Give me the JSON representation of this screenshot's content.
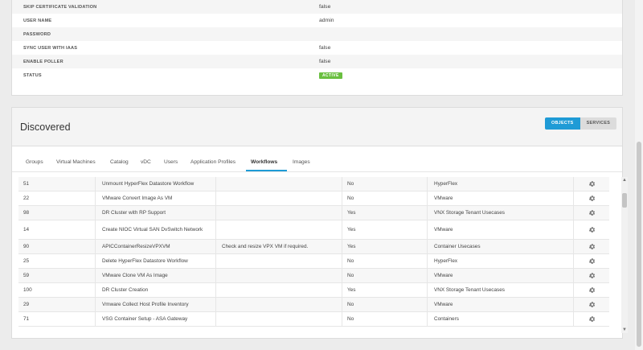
{
  "properties": [
    {
      "key": "SKIP CERTIFICATE VALIDATION",
      "value": "false"
    },
    {
      "key": "USER NAME",
      "value": "admin"
    },
    {
      "key": "PASSWORD",
      "value": ""
    },
    {
      "key": "SYNC USER WITH IAAS",
      "value": "false"
    },
    {
      "key": "ENABLE POLLER",
      "value": "false"
    },
    {
      "key": "STATUS",
      "value": "ACTIVE"
    }
  ],
  "discovered": {
    "title": "Discovered",
    "toggle": {
      "objects": "OBJECTS",
      "services": "SERVICES"
    }
  },
  "tabs": [
    {
      "label": "Groups"
    },
    {
      "label": "Virtual Machines"
    },
    {
      "label": "Catalog"
    },
    {
      "label": "vDC"
    },
    {
      "label": "Users"
    },
    {
      "label": "Application Profiles"
    },
    {
      "label": "Workflows"
    },
    {
      "label": "Images"
    }
  ],
  "workflows": [
    {
      "id": "51",
      "name": "Unmount HyperFlex Datastore Workflow",
      "desc": "",
      "val": "No",
      "cat": "HyperFlex"
    },
    {
      "id": "22",
      "name": "VMware Convert Image As VM",
      "desc": "",
      "val": "No",
      "cat": "VMware"
    },
    {
      "id": "98",
      "name": "DR Cluster with RP Support",
      "desc": "",
      "val": "Yes",
      "cat": "VNX Storage Tenant Usecases"
    },
    {
      "id": "14",
      "name": "Create NIOC Virtual SAN DvSwitch Network",
      "desc": "",
      "val": "Yes",
      "cat": "VMware"
    },
    {
      "id": "90",
      "name": "APICContainerResizeVPXVM",
      "desc": "Check and resize VPX VM if required.",
      "val": "Yes",
      "cat": "Container Usecases"
    },
    {
      "id": "25",
      "name": "Delete HyperFlex Datastore Workflow",
      "desc": "",
      "val": "No",
      "cat": "HyperFlex"
    },
    {
      "id": "59",
      "name": "VMware Clone VM As Image",
      "desc": "",
      "val": "No",
      "cat": "VMware"
    },
    {
      "id": "100",
      "name": "DR Cluster Creation",
      "desc": "",
      "val": "Yes",
      "cat": "VNX Storage Tenant Usecases"
    },
    {
      "id": "29",
      "name": "Vmware Collect Host Profile Inventory",
      "desc": "",
      "val": "No",
      "cat": "VMware"
    },
    {
      "id": "71",
      "name": "VSG Container Setup - ASA Gateway",
      "desc": "",
      "val": "No",
      "cat": "Containers"
    }
  ],
  "scroll": {
    "up": "▲",
    "down": "▼"
  }
}
